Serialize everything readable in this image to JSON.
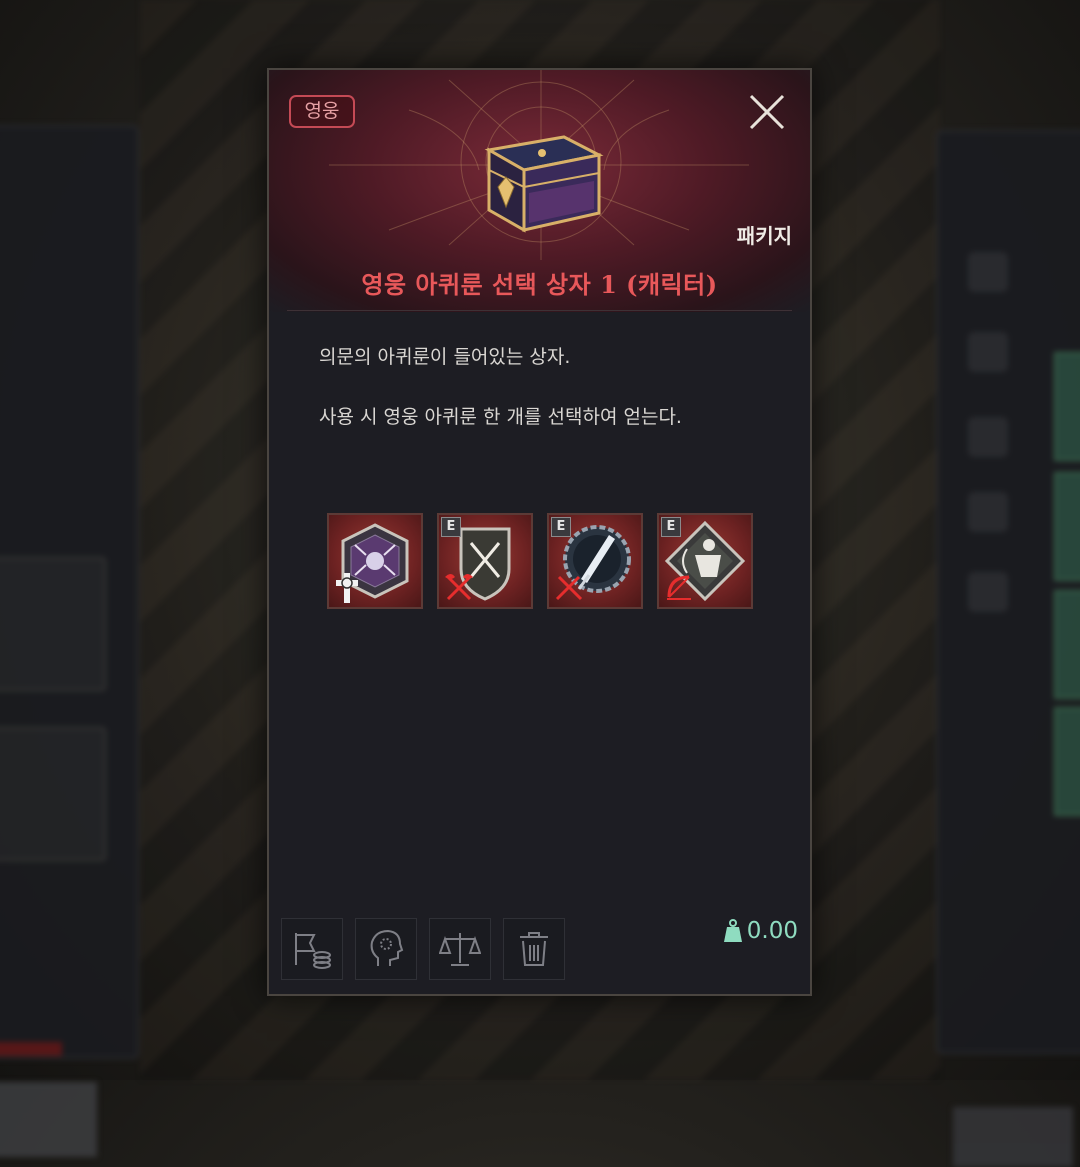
{
  "tooltip": {
    "rarity": "영웅",
    "category": "패키지",
    "title": "영웅 아퀴룬 선택 상자 1 (캐릭터)",
    "description": [
      "의문의 아퀴룬이 들어있는 상자.",
      "사용 시 영웅 아퀴룬 한 개를 선택하여 얻는다."
    ],
    "runes": [
      {
        "icon": "spider-rune-icon",
        "tier": "",
        "class_icon": "cross-class-icon"
      },
      {
        "icon": "crossed-swords-rune-icon",
        "tier": "E",
        "class_icon": "axe-class-icon"
      },
      {
        "icon": "blade-rune-icon",
        "tier": "E",
        "class_icon": "sword-class-icon"
      },
      {
        "icon": "archer-rune-icon",
        "tier": "E",
        "class_icon": "bow-class-icon"
      }
    ],
    "actions": [
      {
        "name": "sell-button",
        "icon": "sell-icon"
      },
      {
        "name": "skill-button",
        "icon": "head-gear-icon"
      },
      {
        "name": "trade-button",
        "icon": "scale-icon"
      },
      {
        "name": "discard-button",
        "icon": "trash-icon"
      }
    ],
    "weight": "0.00"
  },
  "colors": {
    "rarity_accent": "#c44a55",
    "title": "#e8585a",
    "weight": "#8fdcc0",
    "panel_bg": "#1d1d23"
  }
}
